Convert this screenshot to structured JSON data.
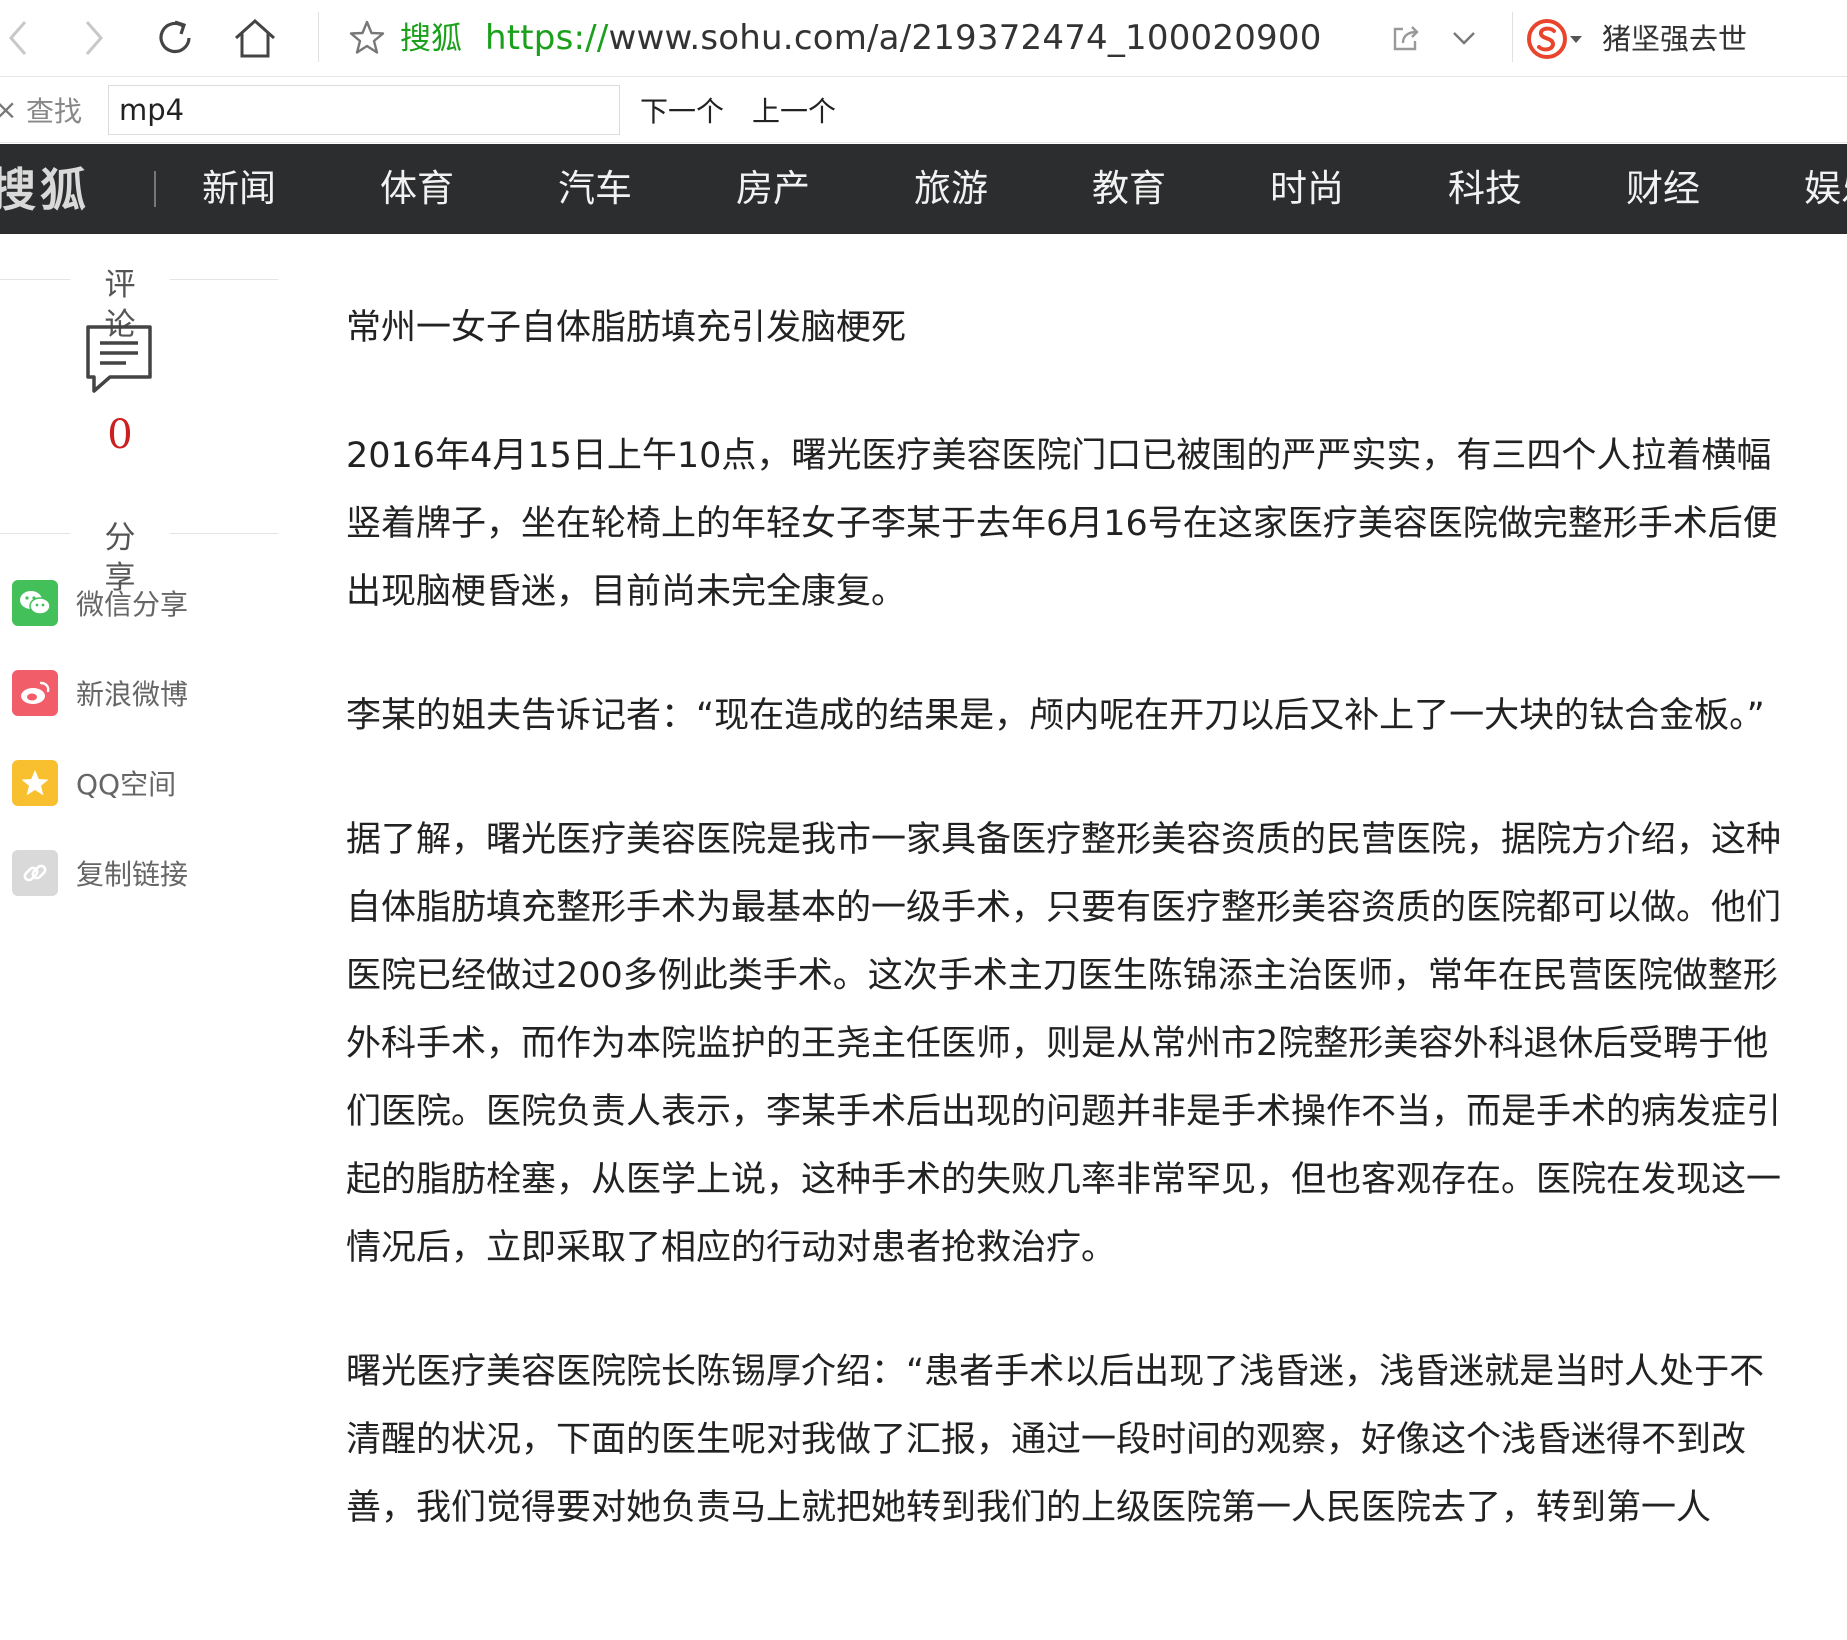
{
  "browser": {
    "site_name": "搜狐",
    "url_scheme": "https://",
    "url_rest": "www.sohu.com/a/219372474_100020900",
    "user_name": "猪坚强去世"
  },
  "findbar": {
    "label": "查找",
    "query": "mp4",
    "next_label": "下一个",
    "prev_label": "上一个"
  },
  "sohu_nav": {
    "logo": "搜狐",
    "items": [
      "新闻",
      "体育",
      "汽车",
      "房产",
      "旅游",
      "教育",
      "时尚",
      "科技",
      "财经",
      "娱乐"
    ]
  },
  "rail": {
    "comment_title": "评论",
    "comment_count": "0",
    "share_title": "分享",
    "share_items": [
      {
        "label": "微信分享",
        "icon": "wechat-icon",
        "color": "#43c05a"
      },
      {
        "label": "新浪微博",
        "icon": "weibo-icon",
        "color": "#f25d6a"
      },
      {
        "label": "QQ空间",
        "icon": "qzone-icon",
        "color": "#f8c02f"
      },
      {
        "label": "复制链接",
        "icon": "link-icon",
        "color": "#d9d9d9"
      }
    ]
  },
  "article": {
    "title": "常州一女子自体脂肪填充引发脑梗死",
    "paragraphs": [
      "2016年4月15日上午10点，曙光医疗美容医院门口已被围的严严实实，有三四个人拉着横幅竖着牌子，坐在轮椅上的年轻女子李某于去年6月16号在这家医疗美容医院做完整形手术后便出现脑梗昏迷，目前尚未完全康复。",
      "李某的姐夫告诉记者：“现在造成的结果是，颅内呢在开刀以后又补上了一大块的钛合金板。”",
      "据了解，曙光医疗美容医院是我市一家具备医疗整形美容资质的民营医院，据院方介绍，这种自体脂肪填充整形手术为最基本的一级手术，只要有医疗整形美容资质的医院都可以做。他们医院已经做过200多例此类手术。这次手术主刀医生陈锦添主治医师，常年在民营医院做整形外科手术，而作为本院监护的王尧主任医师，则是从常州市2院整形美容外科退休后受聘于他们医院。医院负责人表示，李某手术后出现的问题并非是手术操作不当，而是手术的病发症引起的脂肪栓塞，从医学上说，这种手术的失败几率非常罕见，但也客观存在。医院在发现这一情况后，立即采取了相应的行动对患者抢救治疗。",
      "曙光医疗美容医院院长陈锡厚介绍：“患者手术以后出现了浅昏迷，浅昏迷就是当时人处于不清醒的状况，下面的医生呢对我做了汇报，通过一段时间的观察，好像这个浅昏迷得不到改善，我们觉得要对她负责马上就把她转到我们的上级医院第一人民医院去了，转到第一人"
    ]
  },
  "colors": {
    "nav_bg": "#2b2d2f",
    "url_green": "#1aa01a",
    "comment_red": "#cc1f1f"
  }
}
